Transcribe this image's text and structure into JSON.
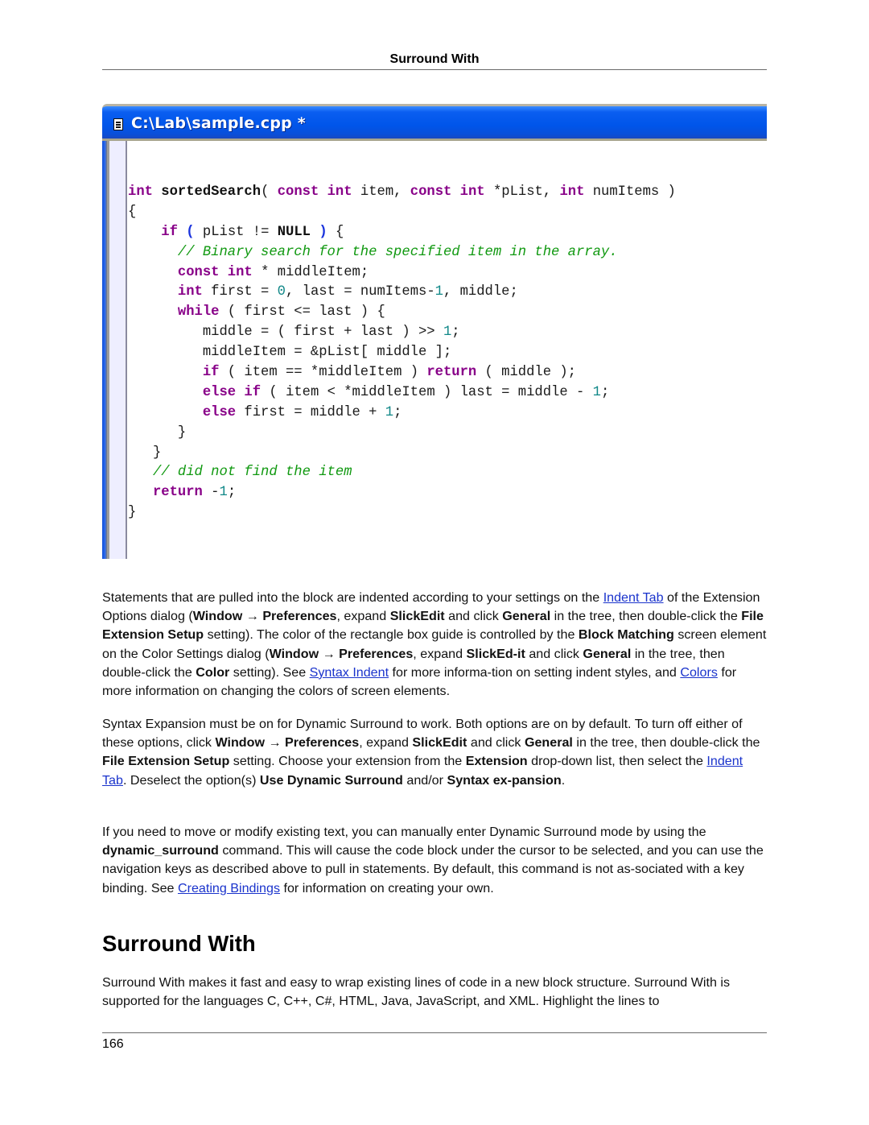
{
  "running_header": "Surround With",
  "screenshot": {
    "window_title": "C:\\Lab\\sample.cpp *",
    "icon": "document-icon",
    "code_lines": [
      [
        {
          "t": "int",
          "c": "kw"
        },
        {
          "t": " "
        },
        {
          "t": "sortedSearch",
          "c": "fn"
        },
        {
          "t": "( "
        },
        {
          "t": "const",
          "c": "kw"
        },
        {
          "t": " "
        },
        {
          "t": "int",
          "c": "kw"
        },
        {
          "t": " item, "
        },
        {
          "t": "const",
          "c": "kw"
        },
        {
          "t": " "
        },
        {
          "t": "int",
          "c": "kw"
        },
        {
          "t": " *pList, "
        },
        {
          "t": "int",
          "c": "kw"
        },
        {
          "t": " numItems )"
        }
      ],
      [
        {
          "t": "{"
        }
      ],
      [
        {
          "t": "    "
        },
        {
          "t": "if",
          "c": "kw"
        },
        {
          "t": " "
        },
        {
          "t": "(",
          "c": "bp"
        },
        {
          "t": " pList != "
        },
        {
          "t": "NULL",
          "c": "nl"
        },
        {
          "t": " "
        },
        {
          "t": ")",
          "c": "bp"
        },
        {
          "t": " {"
        }
      ],
      [
        {
          "t": "      "
        },
        {
          "t": "// Binary search for the specified item in the array.",
          "c": "cm"
        }
      ],
      [
        {
          "t": "      "
        },
        {
          "t": "const",
          "c": "kw"
        },
        {
          "t": " "
        },
        {
          "t": "int",
          "c": "kw"
        },
        {
          "t": " * middleItem;"
        }
      ],
      [
        {
          "t": "      "
        },
        {
          "t": "int",
          "c": "kw"
        },
        {
          "t": " first = "
        },
        {
          "t": "0",
          "c": "nu"
        },
        {
          "t": ", last = numItems-"
        },
        {
          "t": "1",
          "c": "nu"
        },
        {
          "t": ", middle;"
        }
      ],
      [
        {
          "t": "      "
        },
        {
          "t": "while",
          "c": "kw"
        },
        {
          "t": " ( first <= last ) {"
        }
      ],
      [
        {
          "t": "         middle = ( first + last ) >> "
        },
        {
          "t": "1",
          "c": "nu"
        },
        {
          "t": ";"
        }
      ],
      [
        {
          "t": "         middleItem = &pList[ middle ];"
        }
      ],
      [
        {
          "t": "         "
        },
        {
          "t": "if",
          "c": "kw"
        },
        {
          "t": " ( item == *middleItem ) "
        },
        {
          "t": "return",
          "c": "kw"
        },
        {
          "t": " ( middle );"
        }
      ],
      [
        {
          "t": "         "
        },
        {
          "t": "else",
          "c": "kw"
        },
        {
          "t": " "
        },
        {
          "t": "if",
          "c": "kw"
        },
        {
          "t": " ( item < *middleItem ) last = middle - "
        },
        {
          "t": "1",
          "c": "nu"
        },
        {
          "t": ";"
        }
      ],
      [
        {
          "t": "         "
        },
        {
          "t": "else",
          "c": "kw"
        },
        {
          "t": " first = middle + "
        },
        {
          "t": "1",
          "c": "nu"
        },
        {
          "t": ";"
        }
      ],
      [
        {
          "t": "      }"
        }
      ],
      [
        {
          "t": "   }"
        }
      ],
      [
        {
          "t": "   "
        },
        {
          "t": "// did not find the item",
          "c": "cm"
        }
      ],
      [
        {
          "t": "   "
        },
        {
          "t": "return",
          "c": "kw"
        },
        {
          "t": " -"
        },
        {
          "t": "1",
          "c": "nu"
        },
        {
          "t": ";"
        }
      ],
      [
        {
          "t": "}"
        }
      ]
    ]
  },
  "paragraphs": [
    {
      "segments": [
        {
          "t": "Statements that are pulled into the block are indented according to your settings on the "
        },
        {
          "t": "Indent Tab",
          "link": true
        },
        {
          "t": " of the Extension Options dialog ("
        },
        {
          "t": "Window",
          "b": true
        },
        {
          "t": " → "
        },
        {
          "t": "Preferences",
          "b": true
        },
        {
          "t": ", expand "
        },
        {
          "t": "SlickEdit",
          "b": true
        },
        {
          "t": " and click "
        },
        {
          "t": "General",
          "b": true
        },
        {
          "t": " in the tree, then double-click the "
        },
        {
          "t": "File Extension Setup",
          "b": true
        },
        {
          "t": " setting). The color of the rectangle box guide is controlled by the "
        },
        {
          "t": "Block Matching",
          "b": true
        },
        {
          "t": " screen element on the Color Settings dialog ("
        },
        {
          "t": "Window",
          "b": true
        },
        {
          "t": " → "
        },
        {
          "t": "Preferences",
          "b": true
        },
        {
          "t": ", expand "
        },
        {
          "t": "SlickEd-it",
          "b": true
        },
        {
          "t": " and click "
        },
        {
          "t": "General",
          "b": true
        },
        {
          "t": " in the tree, then double-click the "
        },
        {
          "t": "Color",
          "b": true
        },
        {
          "t": " setting). See "
        },
        {
          "t": "Syntax Indent",
          "link": true
        },
        {
          "t": " for more informa-tion on setting indent styles, and "
        },
        {
          "t": "Colors",
          "link": true
        },
        {
          "t": " for more information on changing the colors of screen elements."
        }
      ]
    },
    {
      "segments": [
        {
          "t": "Syntax Expansion must be on for Dynamic Surround to work. Both options are on by default. To turn off either of these options, click "
        },
        {
          "t": "Window",
          "b": true
        },
        {
          "t": " → "
        },
        {
          "t": "Preferences",
          "b": true
        },
        {
          "t": ", expand "
        },
        {
          "t": "SlickEdit",
          "b": true
        },
        {
          "t": " and click "
        },
        {
          "t": "General",
          "b": true
        },
        {
          "t": " in the tree, then double-click the "
        },
        {
          "t": "File Extension Setup",
          "b": true
        },
        {
          "t": " setting. Choose your extension from the "
        },
        {
          "t": "Extension",
          "b": true
        },
        {
          "t": " drop-down list, then select the "
        },
        {
          "t": "Indent Tab",
          "link": true
        },
        {
          "t": ". Deselect the option(s) "
        },
        {
          "t": "Use Dynamic Surround",
          "b": true
        },
        {
          "t": " and/or "
        },
        {
          "t": "Syntax ex-pansion",
          "b": true
        },
        {
          "t": "."
        }
      ]
    },
    {
      "segments": [
        {
          "t": "If you need to move or modify existing text, you can manually enter Dynamic Surround mode by using the "
        },
        {
          "t": "dynamic_surround",
          "b": true
        },
        {
          "t": " command. This will cause the code block under the cursor to be selected, and you can use the navigation keys as described above to pull in statements. By default, this command is not as-sociated with a key binding. See "
        },
        {
          "t": "Creating Bindings",
          "link": true
        },
        {
          "t": " for information on creating your own."
        }
      ]
    }
  ],
  "section": {
    "heading": "Surround With",
    "intro": "Surround With makes it fast and easy to wrap existing lines of code in a new block structure. Surround With is supported for the languages C, C++, C#, HTML, Java, JavaScript, and XML. Highlight the lines to"
  },
  "footer": {
    "page_number": "166"
  },
  "colors": {
    "keyword": "#880088",
    "comment": "#119911",
    "number": "#118888",
    "link": "#1a33cc",
    "titlebar": "#0055ea"
  }
}
